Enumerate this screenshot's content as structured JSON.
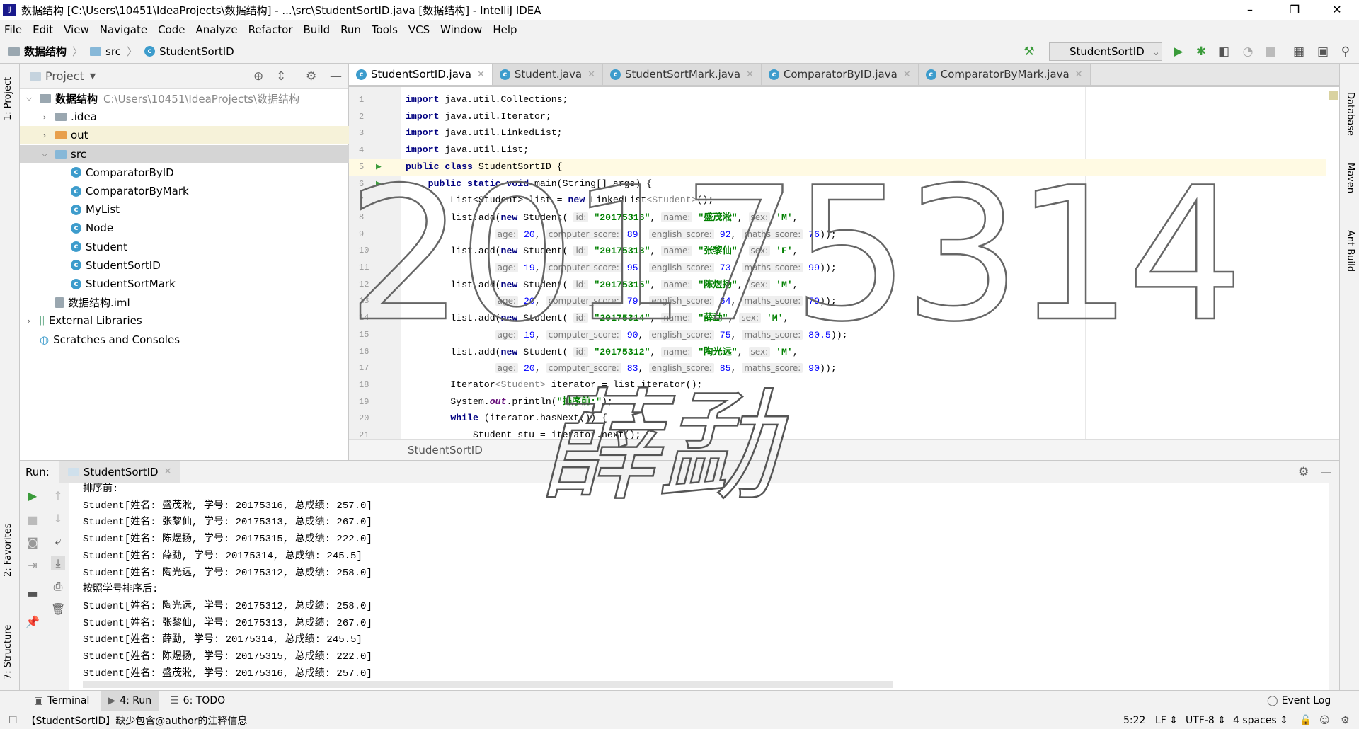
{
  "window": {
    "title": "数据结构 [C:\\Users\\10451\\IdeaProjects\\数据结构] - ...\\src\\StudentSortID.java [数据结构] - IntelliJ IDEA",
    "minimize": "–",
    "restore": "❐",
    "close": "✕"
  },
  "menu": [
    "File",
    "Edit",
    "View",
    "Navigate",
    "Code",
    "Analyze",
    "Refactor",
    "Build",
    "Run",
    "Tools",
    "VCS",
    "Window",
    "Help"
  ],
  "breadcrumb": [
    "数据结构",
    "src",
    "StudentSortID"
  ],
  "toolbar": {
    "run_config": "StudentSortID",
    "icons": [
      "build-hammer-icon",
      "run-icon",
      "debug-icon",
      "coverage-icon",
      "profile-icon",
      "stop-icon",
      "project-structure-icon",
      "terminal-icon",
      "search-icon"
    ],
    "accent": "#3a9b3a"
  },
  "left_strip": {
    "project": "1: Project",
    "favorites": "2: Favorites",
    "structure": "7: Structure"
  },
  "right_strip": {
    "database": "Database",
    "maven": "Maven",
    "ant": "Ant Build"
  },
  "project": {
    "title": "Project",
    "tree": [
      {
        "label": "数据结构",
        "extra": "C:\\Users\\10451\\IdeaProjects\\数据结构",
        "level": 0,
        "icon": "module",
        "arrow": "v"
      },
      {
        "label": ".idea",
        "level": 1,
        "icon": "folder",
        "arrow": ">"
      },
      {
        "label": "out",
        "level": 1,
        "icon": "folder-orange",
        "arrow": ">",
        "state": "hl"
      },
      {
        "label": "src",
        "level": 1,
        "icon": "folder-blue",
        "arrow": "v",
        "state": "sel"
      },
      {
        "label": "ComparatorByID",
        "level": 2,
        "icon": "class"
      },
      {
        "label": "ComparatorByMark",
        "level": 2,
        "icon": "class"
      },
      {
        "label": "MyList",
        "level": 2,
        "icon": "class"
      },
      {
        "label": "Node",
        "level": 2,
        "icon": "class"
      },
      {
        "label": "Student",
        "level": 2,
        "icon": "class"
      },
      {
        "label": "StudentSortID",
        "level": 2,
        "icon": "class"
      },
      {
        "label": "StudentSortMark",
        "level": 2,
        "icon": "class"
      },
      {
        "label": "数据结构.iml",
        "level": 1,
        "icon": "file"
      },
      {
        "label": "External Libraries",
        "level": 0,
        "icon": "library",
        "arrow": ">"
      },
      {
        "label": "Scratches and Consoles",
        "level": 0,
        "icon": "scratch"
      }
    ]
  },
  "tabs": [
    {
      "label": "StudentSortID.java",
      "active": true
    },
    {
      "label": "Student.java"
    },
    {
      "label": "StudentSortMark.java"
    },
    {
      "label": "ComparatorByID.java"
    },
    {
      "label": "ComparatorByMark.java"
    }
  ],
  "code": [
    [
      [
        "k",
        "import"
      ],
      [
        "p",
        " java.util.Collections;"
      ]
    ],
    [
      [
        "k",
        "import"
      ],
      [
        "p",
        " java.util.Iterator;"
      ]
    ],
    [
      [
        "k",
        "import"
      ],
      [
        "p",
        " java.util.LinkedList;"
      ]
    ],
    [
      [
        "k",
        "import"
      ],
      [
        "p",
        " java.util.List;"
      ]
    ],
    [
      [
        "k",
        "public class"
      ],
      [
        "p",
        " StudentSortID {"
      ]
    ],
    [
      [
        "p",
        "    "
      ],
      [
        "k",
        "public static void"
      ],
      [
        "p",
        " main(String[] args) {"
      ]
    ],
    [
      [
        "p",
        "        List<Student> list = "
      ],
      [
        "k",
        "new"
      ],
      [
        "p",
        " LinkedList"
      ],
      [
        "g",
        "<Student>"
      ],
      [
        "p",
        "();"
      ]
    ],
    [
      [
        "p",
        "        list.add("
      ],
      [
        "k",
        "new"
      ],
      [
        "p",
        " Student( "
      ],
      [
        "h",
        "id:"
      ],
      [
        "s",
        " \"20175316\""
      ],
      [
        "p",
        ", "
      ],
      [
        "h",
        "name:"
      ],
      [
        "s",
        " \"盛茂淞\""
      ],
      [
        "p",
        ", "
      ],
      [
        "h",
        "sex:"
      ],
      [
        "s",
        " 'M'"
      ],
      [
        "p",
        ","
      ]
    ],
    [
      [
        "p",
        "                "
      ],
      [
        "h",
        "age:"
      ],
      [
        "n",
        " 20"
      ],
      [
        "p",
        ", "
      ],
      [
        "h",
        "computer_score:"
      ],
      [
        "n",
        " 89"
      ],
      [
        "p",
        ", "
      ],
      [
        "h",
        "english_score:"
      ],
      [
        "n",
        " 92"
      ],
      [
        "p",
        ", "
      ],
      [
        "h",
        "maths_score:"
      ],
      [
        "n",
        " 76"
      ],
      [
        "p",
        "));"
      ]
    ],
    [
      [
        "p",
        "        list.add("
      ],
      [
        "k",
        "new"
      ],
      [
        "p",
        " Student( "
      ],
      [
        "h",
        "id:"
      ],
      [
        "s",
        " \"20175313\""
      ],
      [
        "p",
        ", "
      ],
      [
        "h",
        "name:"
      ],
      [
        "s",
        " \"张黎仙\""
      ],
      [
        "p",
        ", "
      ],
      [
        "h",
        "sex:"
      ],
      [
        "s",
        " 'F'"
      ],
      [
        "p",
        ","
      ]
    ],
    [
      [
        "p",
        "                "
      ],
      [
        "h",
        "age:"
      ],
      [
        "n",
        " 19"
      ],
      [
        "p",
        ", "
      ],
      [
        "h",
        "computer_score:"
      ],
      [
        "n",
        " 95"
      ],
      [
        "p",
        ", "
      ],
      [
        "h",
        "english_score:"
      ],
      [
        "n",
        " 73"
      ],
      [
        "p",
        ", "
      ],
      [
        "h",
        "maths_score:"
      ],
      [
        "n",
        " 99"
      ],
      [
        "p",
        "));"
      ]
    ],
    [
      [
        "p",
        "        list.add("
      ],
      [
        "k",
        "new"
      ],
      [
        "p",
        " Student( "
      ],
      [
        "h",
        "id:"
      ],
      [
        "s",
        " \"20175315\""
      ],
      [
        "p",
        ", "
      ],
      [
        "h",
        "name:"
      ],
      [
        "s",
        " \"陈煜扬\""
      ],
      [
        "p",
        ", "
      ],
      [
        "h",
        "sex:"
      ],
      [
        "s",
        " 'M'"
      ],
      [
        "p",
        ","
      ]
    ],
    [
      [
        "p",
        "                "
      ],
      [
        "h",
        "age:"
      ],
      [
        "n",
        " 20"
      ],
      [
        "p",
        ", "
      ],
      [
        "h",
        "computer_score:"
      ],
      [
        "n",
        " 79"
      ],
      [
        "p",
        ", "
      ],
      [
        "h",
        "english_score:"
      ],
      [
        "n",
        " 64"
      ],
      [
        "p",
        ", "
      ],
      [
        "h",
        "maths_score:"
      ],
      [
        "n",
        " 79"
      ],
      [
        "p",
        "));"
      ]
    ],
    [
      [
        "p",
        "        list.add("
      ],
      [
        "k",
        "new"
      ],
      [
        "p",
        " Student( "
      ],
      [
        "h",
        "id:"
      ],
      [
        "s",
        " \"20175314\""
      ],
      [
        "p",
        ", "
      ],
      [
        "h",
        "name:"
      ],
      [
        "s",
        " \"薛勐\""
      ],
      [
        "p",
        ", "
      ],
      [
        "h",
        "sex:"
      ],
      [
        "s",
        " 'M'"
      ],
      [
        "p",
        ","
      ]
    ],
    [
      [
        "p",
        "                "
      ],
      [
        "h",
        "age:"
      ],
      [
        "n",
        " 19"
      ],
      [
        "p",
        ", "
      ],
      [
        "h",
        "computer_score:"
      ],
      [
        "n",
        " 90"
      ],
      [
        "p",
        ", "
      ],
      [
        "h",
        "english_score:"
      ],
      [
        "n",
        " 75"
      ],
      [
        "p",
        ", "
      ],
      [
        "h",
        "maths_score:"
      ],
      [
        "n",
        " 80.5"
      ],
      [
        "p",
        "));"
      ]
    ],
    [
      [
        "p",
        "        list.add("
      ],
      [
        "k",
        "new"
      ],
      [
        "p",
        " Student( "
      ],
      [
        "h",
        "id:"
      ],
      [
        "s",
        " \"20175312\""
      ],
      [
        "p",
        ", "
      ],
      [
        "h",
        "name:"
      ],
      [
        "s",
        " \"陶光远\""
      ],
      [
        "p",
        ", "
      ],
      [
        "h",
        "sex:"
      ],
      [
        "s",
        " 'M'"
      ],
      [
        "p",
        ","
      ]
    ],
    [
      [
        "p",
        "                "
      ],
      [
        "h",
        "age:"
      ],
      [
        "n",
        " 20"
      ],
      [
        "p",
        ", "
      ],
      [
        "h",
        "computer_score:"
      ],
      [
        "n",
        " 83"
      ],
      [
        "p",
        ", "
      ],
      [
        "h",
        "english_score:"
      ],
      [
        "n",
        " 85"
      ],
      [
        "p",
        ", "
      ],
      [
        "h",
        "maths_score:"
      ],
      [
        "n",
        " 90"
      ],
      [
        "p",
        "));"
      ]
    ],
    [
      [
        "p",
        "        Iterator"
      ],
      [
        "g",
        "<Student>"
      ],
      [
        "p",
        " iterator = list.iterator();"
      ]
    ],
    [
      [
        "p",
        "        System."
      ],
      [
        "o",
        "out"
      ],
      [
        "p",
        ".println("
      ],
      [
        "s",
        "\"排序前:\""
      ],
      [
        "p",
        ");"
      ]
    ],
    [
      [
        "p",
        "        "
      ],
      [
        "k",
        "while"
      ],
      [
        "p",
        " (iterator.hasNext()) {"
      ]
    ],
    [
      [
        "p",
        "            Student stu = iterator.next();"
      ]
    ]
  ],
  "current_line": 5,
  "editor_breadcrumb": "StudentSortID",
  "run": {
    "label": "Run:",
    "tab": "StudentSortID",
    "output": [
      "排序前:",
      "Student[姓名: 盛茂淞, 学号: 20175316, 总成绩: 257.0]",
      "Student[姓名: 张黎仙, 学号: 20175313, 总成绩: 267.0]",
      "Student[姓名: 陈煜扬, 学号: 20175315, 总成绩: 222.0]",
      "Student[姓名: 薛勐, 学号: 20175314, 总成绩: 245.5]",
      "Student[姓名: 陶光远, 学号: 20175312, 总成绩: 258.0]",
      "按照学号排序后:",
      "Student[姓名: 陶光远, 学号: 20175312, 总成绩: 258.0]",
      "Student[姓名: 张黎仙, 学号: 20175313, 总成绩: 267.0]",
      "Student[姓名: 薛勐, 学号: 20175314, 总成绩: 245.5]",
      "Student[姓名: 陈煜扬, 学号: 20175315, 总成绩: 222.0]",
      "Student[姓名: 盛茂淞, 学号: 20175316, 总成绩: 257.0]"
    ]
  },
  "bottom_tabs": [
    {
      "label": "Terminal"
    },
    {
      "label": "4: Run",
      "active": true
    },
    {
      "label": "6: TODO"
    }
  ],
  "event_log": "Event Log",
  "status": {
    "message": "【StudentSortID】缺少包含@author的注释信息",
    "position": "5:22",
    "line_sep": "LF",
    "encoding": "UTF-8",
    "indent": "4 spaces"
  },
  "watermark": {
    "number": "20175314",
    "name": "薛勐"
  }
}
